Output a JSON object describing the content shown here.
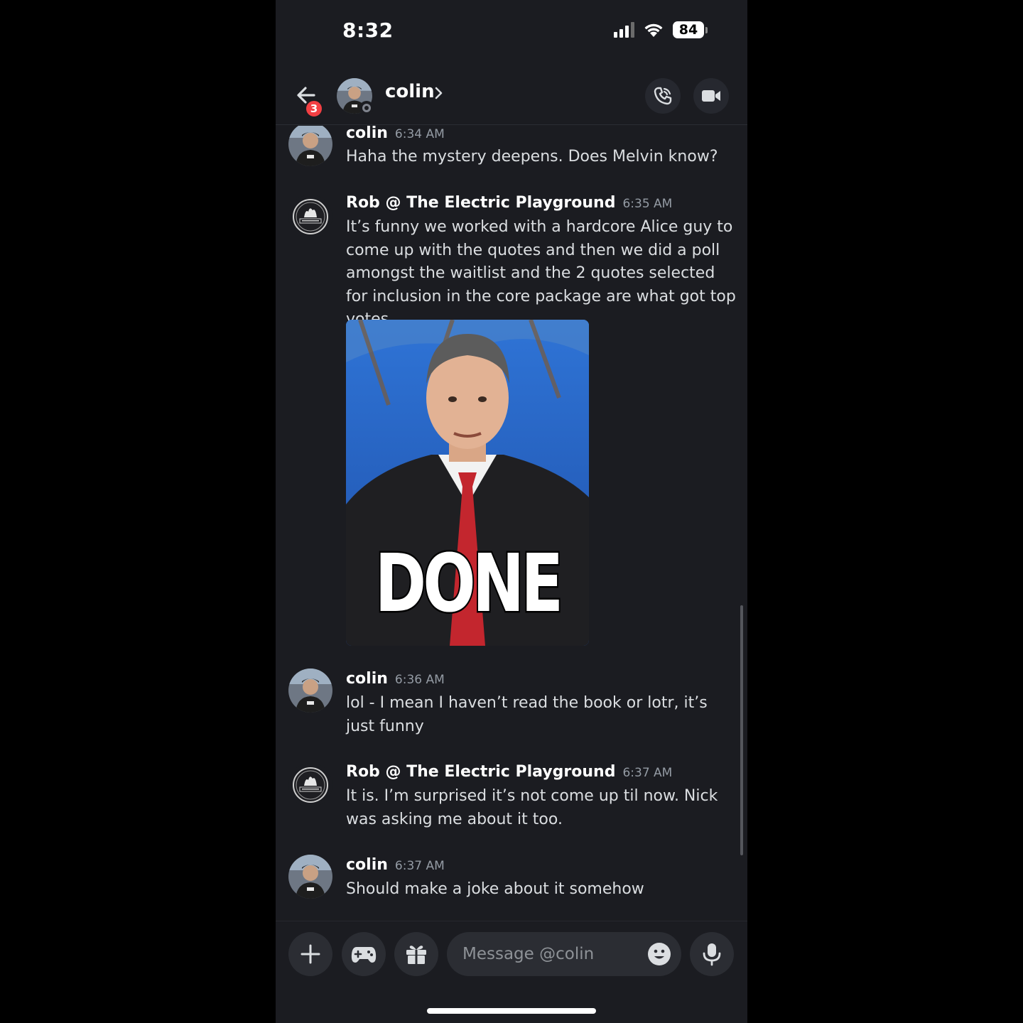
{
  "status_bar": {
    "time": "8:32",
    "battery": "84"
  },
  "header": {
    "back_badge": "3",
    "contact_name": "colin",
    "chevron": "›",
    "call_icon": "phone-icon",
    "video_icon": "video-camera-icon"
  },
  "messages": [
    {
      "author": "colin",
      "time": "6:34 AM",
      "text": "Haha the mystery deepens. Does Melvin know?"
    },
    {
      "author": "Rob @ The Electric Playground",
      "time": "6:35 AM",
      "text": "It’s funny we worked with a hardcore Alice guy to come up with the quotes and then we did a poll amongst the waitlist and the 2 quotes selected for inclusion in the core package are what got top votes",
      "gif_caption": "DONE"
    },
    {
      "author": "colin",
      "time": "6:36 AM",
      "text": "lol - I mean I haven’t read the book or lotr, it’s just funny"
    },
    {
      "author": "Rob @ The Electric Playground",
      "time": "6:37 AM",
      "text": "It is. I’m surprised it’s not come up til now. Nick was asking me about it too."
    },
    {
      "author": "colin",
      "time": "6:37 AM",
      "text": "Should make a joke about it somehow"
    }
  ],
  "composer": {
    "placeholder": "Message @colin",
    "buttons": [
      "plus-icon",
      "gamepad-icon",
      "gift-icon",
      "emoji-icon",
      "microphone-icon"
    ]
  },
  "colors": {
    "background": "#1b1c21",
    "badge": "#f23f43",
    "muted_text": "#949ba4"
  }
}
